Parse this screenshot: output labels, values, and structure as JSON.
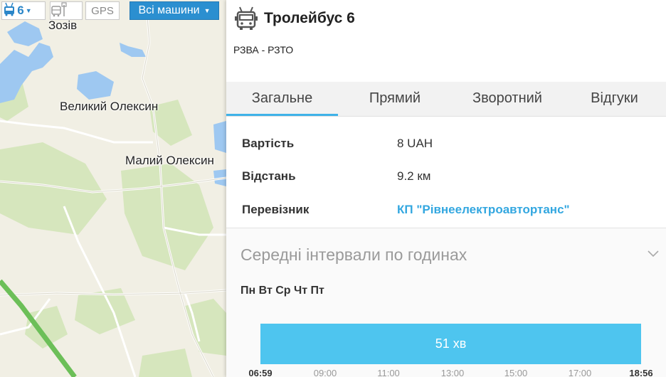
{
  "toolbar": {
    "route_number": "6",
    "gps_label": "GPS",
    "all_cars_label": "Всі машини"
  },
  "map": {
    "labels": {
      "zoziv": "Зозів",
      "velykyi_oleksyn": "Великий Олексин",
      "malyi_oleksyn": "Малий Олексин"
    },
    "colors": {
      "land": "#f1efe4",
      "water": "#9ac5f0",
      "forest": "#d4e5b9",
      "route": "#6cbf58"
    }
  },
  "panel": {
    "title": "Тролейбус 6",
    "subtitle": "РЗВА - РЗТО",
    "tabs": [
      {
        "label": "Загальне",
        "active": true
      },
      {
        "label": "Прямий",
        "active": false
      },
      {
        "label": "Зворотний",
        "active": false
      },
      {
        "label": "Відгуки",
        "active": false
      }
    ],
    "info": {
      "cost_label": "Вартість",
      "cost_value": "8 UAH",
      "distance_label": "Відстань",
      "distance_value": "9.2 км",
      "carrier_label": "Перевізник",
      "carrier_value": "КП \"Рівнеелектроавтортанс\""
    },
    "intervals": {
      "title": "Середні інтервали по годинах",
      "days": "Пн Вт Ср Чт Пт",
      "bar_label": "51 хв",
      "start": "06:59",
      "end": "18:56",
      "ticks": [
        "09:00",
        "11:00",
        "13:00",
        "15:00",
        "17:00"
      ]
    }
  },
  "colors": {
    "accent": "#3fb2e8",
    "bar": "#4ec5ef",
    "button_blue": "#2b8fd0"
  }
}
